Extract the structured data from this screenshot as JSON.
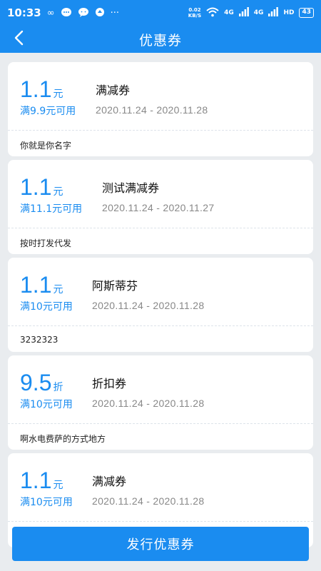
{
  "status_bar": {
    "time": "10:33",
    "net_speed_value": "0.02",
    "net_speed_unit": "KB/S",
    "signal1_label": "4G",
    "signal2_label": "4G",
    "hd_label": "HD",
    "battery": "43"
  },
  "header": {
    "title": "优惠券"
  },
  "coupons": [
    {
      "value": "1.1",
      "unit": "元",
      "condition": "满9.9元可用",
      "name": "满减券",
      "date": "2020.11.24 - 2020.11.28",
      "description": "你就是你名字"
    },
    {
      "value": "1.1",
      "unit": "元",
      "condition": "满11.1元可用",
      "name": "测试满减券",
      "date": "2020.11.24 - 2020.11.27",
      "description": "按时打发代发"
    },
    {
      "value": "1.1",
      "unit": "元",
      "condition": "满10元可用",
      "name": "阿斯蒂芬",
      "date": "2020.11.24 - 2020.11.28",
      "description": "3232323"
    },
    {
      "value": "9.5",
      "unit": "折",
      "condition": "满10元可用",
      "name": "折扣券",
      "date": "2020.11.24 - 2020.11.28",
      "description": "啊水电费萨的方式地方"
    },
    {
      "value": "1.1",
      "unit": "元",
      "condition": "满10元可用",
      "name": "满减券",
      "date": "2020.11.24 - 2020.11.28",
      "description": ""
    }
  ],
  "footer": {
    "issue_button_label": "发行优惠券"
  },
  "colors": {
    "primary": "#1a8cf0",
    "background": "#e9ecef"
  }
}
